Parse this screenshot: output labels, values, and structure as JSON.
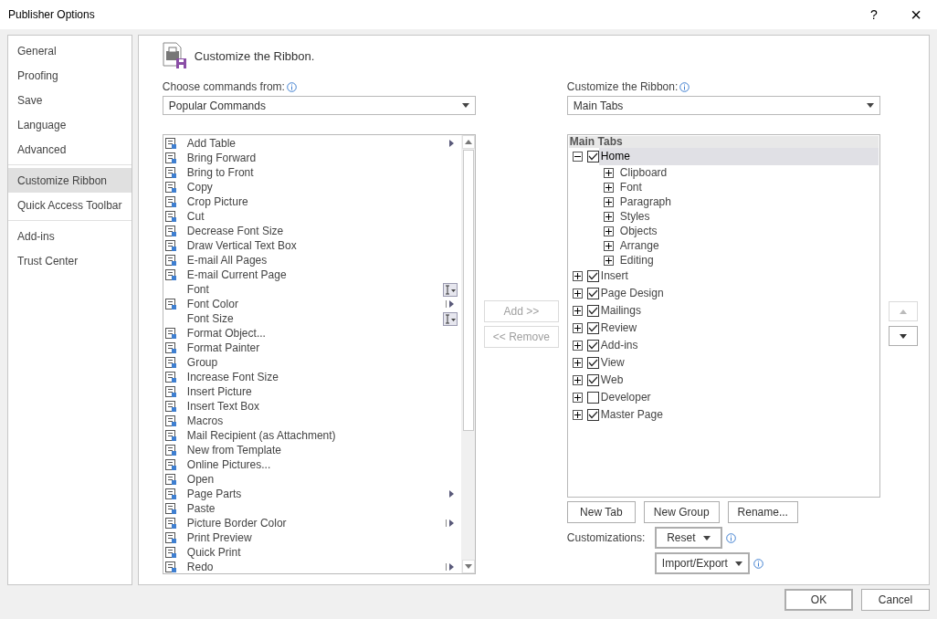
{
  "window": {
    "title": "Publisher Options",
    "buttons": [
      "?",
      "×"
    ]
  },
  "sidebar": {
    "groups": [
      [
        {
          "label": "General",
          "selected": false
        },
        {
          "label": "Proofing",
          "selected": false
        },
        {
          "label": "Save",
          "selected": false
        },
        {
          "label": "Language",
          "selected": false
        },
        {
          "label": "Advanced",
          "selected": false
        }
      ],
      [
        {
          "label": "Customize Ribbon",
          "selected": true
        },
        {
          "label": "Quick Access Toolbar",
          "selected": false
        }
      ],
      [
        {
          "label": "Add-ins",
          "selected": false
        },
        {
          "label": "Trust Center",
          "selected": false
        }
      ]
    ]
  },
  "heading": "Customize the Ribbon.",
  "commands_source": {
    "label": "Choose commands from:",
    "value": "Popular Commands"
  },
  "commands": [
    {
      "label": "Add Table",
      "icon": true,
      "kind": "submenu"
    },
    {
      "label": "Bring Forward",
      "icon": true,
      "kind": "plain"
    },
    {
      "label": "Bring to Front",
      "icon": true,
      "kind": "plain"
    },
    {
      "label": "Copy",
      "icon": true,
      "kind": "plain"
    },
    {
      "label": "Crop Picture",
      "icon": true,
      "kind": "plain"
    },
    {
      "label": "Cut",
      "icon": true,
      "kind": "plain"
    },
    {
      "label": "Decrease Font Size",
      "icon": true,
      "kind": "plain"
    },
    {
      "label": "Draw Vertical Text Box",
      "icon": true,
      "kind": "plain"
    },
    {
      "label": "E-mail All Pages",
      "icon": true,
      "kind": "plain"
    },
    {
      "label": "E-mail Current Page",
      "icon": true,
      "kind": "plain"
    },
    {
      "label": "Font",
      "icon": false,
      "kind": "picker"
    },
    {
      "label": "Font Color",
      "icon": true,
      "kind": "split"
    },
    {
      "label": "Font Size",
      "icon": false,
      "kind": "picker"
    },
    {
      "label": "Format Object...",
      "icon": true,
      "kind": "plain"
    },
    {
      "label": "Format Painter",
      "icon": true,
      "kind": "plain"
    },
    {
      "label": "Group",
      "icon": true,
      "kind": "plain"
    },
    {
      "label": "Increase Font Size",
      "icon": true,
      "kind": "plain"
    },
    {
      "label": "Insert Picture",
      "icon": true,
      "kind": "plain"
    },
    {
      "label": "Insert Text Box",
      "icon": true,
      "kind": "plain"
    },
    {
      "label": "Macros",
      "icon": true,
      "kind": "plain"
    },
    {
      "label": "Mail Recipient (as Attachment)",
      "icon": true,
      "kind": "plain"
    },
    {
      "label": "New from Template",
      "icon": true,
      "kind": "plain"
    },
    {
      "label": "Online Pictures...",
      "icon": true,
      "kind": "plain"
    },
    {
      "label": "Open",
      "icon": true,
      "kind": "plain"
    },
    {
      "label": "Page Parts",
      "icon": true,
      "kind": "submenu"
    },
    {
      "label": "Paste",
      "icon": true,
      "kind": "plain"
    },
    {
      "label": "Picture Border Color",
      "icon": true,
      "kind": "split"
    },
    {
      "label": "Print Preview",
      "icon": true,
      "kind": "plain"
    },
    {
      "label": "Quick Print",
      "icon": true,
      "kind": "plain"
    },
    {
      "label": "Redo",
      "icon": true,
      "kind": "split"
    }
  ],
  "transfer_buttons": [
    {
      "label": "Add >>",
      "disabled": true
    },
    {
      "label": "<< Remove",
      "disabled": true
    }
  ],
  "ribbon_target": {
    "label": "Customize the Ribbon:",
    "value": "Main Tabs"
  },
  "ribbon_tree": {
    "header": "Main Tabs",
    "tabs": [
      {
        "label": "Home",
        "checked": true,
        "expanded": true,
        "selected": true,
        "children": [
          {
            "label": "Clipboard"
          },
          {
            "label": "Font"
          },
          {
            "label": "Paragraph"
          },
          {
            "label": "Styles"
          },
          {
            "label": "Objects"
          },
          {
            "label": "Arrange"
          },
          {
            "label": "Editing"
          }
        ]
      },
      {
        "label": "Insert",
        "checked": true,
        "expanded": false,
        "selected": false
      },
      {
        "label": "Page Design",
        "checked": true,
        "expanded": false,
        "selected": false
      },
      {
        "label": "Mailings",
        "checked": true,
        "expanded": false,
        "selected": false
      },
      {
        "label": "Review",
        "checked": true,
        "expanded": false,
        "selected": false
      },
      {
        "label": "Add-ins",
        "checked": true,
        "expanded": false,
        "selected": false
      },
      {
        "label": "View",
        "checked": true,
        "expanded": false,
        "selected": false
      },
      {
        "label": "Web",
        "checked": true,
        "expanded": false,
        "selected": false
      },
      {
        "label": "Developer",
        "checked": false,
        "expanded": false,
        "selected": false
      },
      {
        "label": "Master Page",
        "checked": true,
        "expanded": false,
        "selected": false
      }
    ]
  },
  "move_buttons": [
    {
      "kind": "up",
      "disabled": true
    },
    {
      "kind": "down",
      "disabled": false
    }
  ],
  "tree_buttons": [
    "New Tab",
    "New Group",
    "Rename..."
  ],
  "customizations": {
    "label": "Customizations:",
    "reset": "Reset",
    "import_export": "Import/Export"
  },
  "footer_buttons": [
    {
      "label": "OK",
      "default": true
    },
    {
      "label": "Cancel",
      "default": false
    }
  ]
}
